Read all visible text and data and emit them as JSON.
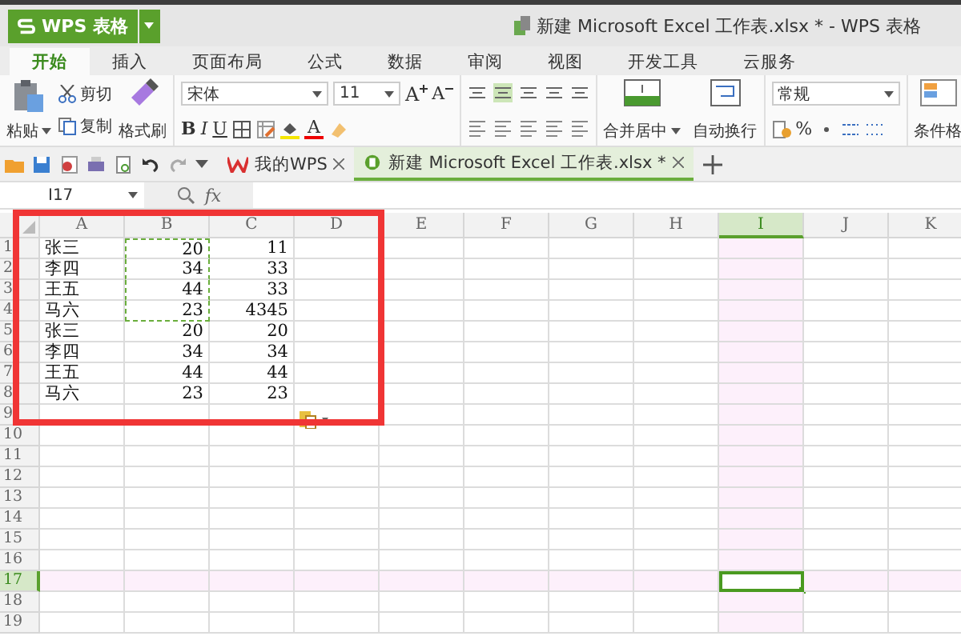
{
  "app_button": {
    "label": "WPS 表格"
  },
  "window": {
    "title": "新建 Microsoft Excel 工作表.xlsx * - WPS 表格"
  },
  "tabs": [
    {
      "label": "开始",
      "selected": true
    },
    {
      "label": "插入",
      "selected": false
    },
    {
      "label": "页面布局",
      "selected": false
    },
    {
      "label": "公式",
      "selected": false
    },
    {
      "label": "数据",
      "selected": false
    },
    {
      "label": "审阅",
      "selected": false
    },
    {
      "label": "视图",
      "selected": false
    },
    {
      "label": "开发工具",
      "selected": false
    },
    {
      "label": "云服务",
      "selected": false
    }
  ],
  "ribbon": {
    "clipboard": {
      "paste": "粘贴",
      "cut": "剪切",
      "copy": "复制",
      "format_painter": "格式刷"
    },
    "font": {
      "name": "宋体",
      "size": "11",
      "grow": "A",
      "shrink": "A",
      "bold": "B",
      "italic": "I",
      "underline": "U",
      "font_color": "A"
    },
    "alignment": {
      "merge": "合并居中",
      "wrap": "自动换行"
    },
    "number": {
      "format": "常规",
      "percent": "%"
    },
    "conditional_format": "条件格"
  },
  "doc_tabs": [
    {
      "label": "我的WPS",
      "selected": false
    },
    {
      "label": "新建 Microsoft Excel 工作表.xlsx *",
      "selected": true
    }
  ],
  "formula_bar": {
    "name_box": "I17",
    "fx": "fx"
  },
  "sheet": {
    "columns": [
      {
        "label": "A",
        "selected": false
      },
      {
        "label": "B",
        "selected": false
      },
      {
        "label": "C",
        "selected": false
      },
      {
        "label": "D",
        "selected": false
      },
      {
        "label": "E",
        "selected": false
      },
      {
        "label": "F",
        "selected": false
      },
      {
        "label": "G",
        "selected": false
      },
      {
        "label": "H",
        "selected": false
      },
      {
        "label": "I",
        "selected": true
      },
      {
        "label": "J",
        "selected": false
      },
      {
        "label": "K",
        "selected": false
      }
    ],
    "rows": [
      {
        "label": "1",
        "selected": false,
        "cells": [
          {
            "text": "张三",
            "copied": false
          },
          {
            "text": "20",
            "copied": true
          },
          {
            "text": "11",
            "copied": false
          }
        ]
      },
      {
        "label": "2",
        "selected": false,
        "cells": [
          {
            "text": "李四",
            "copied": false
          },
          {
            "text": "34",
            "copied": true
          },
          {
            "text": "33",
            "copied": false
          }
        ]
      },
      {
        "label": "3",
        "selected": false,
        "cells": [
          {
            "text": "王五",
            "copied": false
          },
          {
            "text": "44",
            "copied": true
          },
          {
            "text": "33",
            "copied": false
          }
        ]
      },
      {
        "label": "4",
        "selected": false,
        "cells": [
          {
            "text": "马六",
            "copied": false
          },
          {
            "text": "23",
            "copied": true
          },
          {
            "text": "4345",
            "copied": false
          }
        ]
      },
      {
        "label": "5",
        "selected": false,
        "cells": [
          {
            "text": "张三",
            "copied": false
          },
          {
            "text": "20",
            "copied": false
          },
          {
            "text": "20",
            "copied": false
          }
        ]
      },
      {
        "label": "6",
        "selected": false,
        "cells": [
          {
            "text": "李四",
            "copied": false
          },
          {
            "text": "34",
            "copied": false
          },
          {
            "text": "34",
            "copied": false
          }
        ]
      },
      {
        "label": "7",
        "selected": false,
        "cells": [
          {
            "text": "王五",
            "copied": false
          },
          {
            "text": "44",
            "copied": false
          },
          {
            "text": "44",
            "copied": false
          }
        ]
      },
      {
        "label": "8",
        "selected": false,
        "cells": [
          {
            "text": "马六",
            "copied": false
          },
          {
            "text": "23",
            "copied": false
          },
          {
            "text": "23",
            "copied": false
          }
        ]
      },
      {
        "label": "9",
        "selected": false,
        "cells": []
      },
      {
        "label": "10",
        "selected": false,
        "cells": []
      },
      {
        "label": "11",
        "selected": false,
        "cells": []
      },
      {
        "label": "12",
        "selected": false,
        "cells": []
      },
      {
        "label": "13",
        "selected": false,
        "cells": []
      },
      {
        "label": "14",
        "selected": false,
        "cells": []
      },
      {
        "label": "15",
        "selected": false,
        "cells": []
      },
      {
        "label": "16",
        "selected": false,
        "cells": []
      },
      {
        "label": "17",
        "selected": true,
        "cells": []
      },
      {
        "label": "18",
        "selected": false,
        "cells": []
      },
      {
        "label": "19",
        "selected": false,
        "cells": []
      }
    ]
  }
}
